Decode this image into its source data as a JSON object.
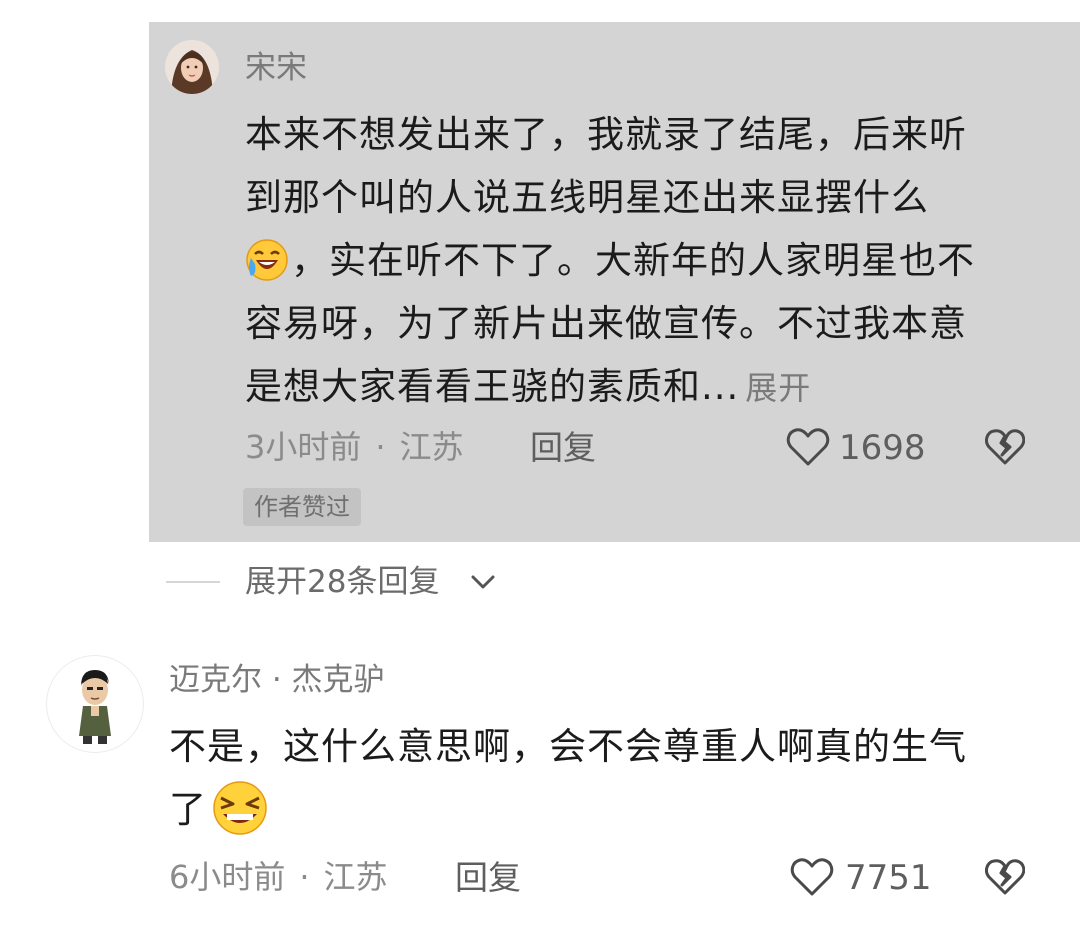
{
  "comment_a": {
    "author": "宋宋",
    "lines": [
      "本来不想发出来了，我就录了结尾，后来听",
      "到那个叫的人说五线明星还出来显摆什么",
      "，实在听不下了。大新年的人家明星也不",
      "容易呀，为了新片出来做宣传。不过我本意",
      "是想大家看看王骁的素质和..."
    ],
    "expand_label": "展开",
    "emoji": "laughing-crying-emoji",
    "time": "3小时前",
    "location": "江苏",
    "reply_label": "回复",
    "likes": "1698",
    "badge": "作者赞过"
  },
  "expand_replies": {
    "label": "展开28条回复"
  },
  "comment_b": {
    "author": "迈克尔 · 杰克驴",
    "lines": [
      "不是，这什么意思啊，会不会尊重人啊真的生气",
      "了"
    ],
    "emoji": "angry-grin-emoji",
    "time": "6小时前",
    "location": "江苏",
    "reply_label": "回复",
    "likes": "7751"
  },
  "colors": {
    "highlight_bg": "#d4d4d4",
    "text": "#1b1b1b",
    "meta": "#8b8b8b"
  }
}
